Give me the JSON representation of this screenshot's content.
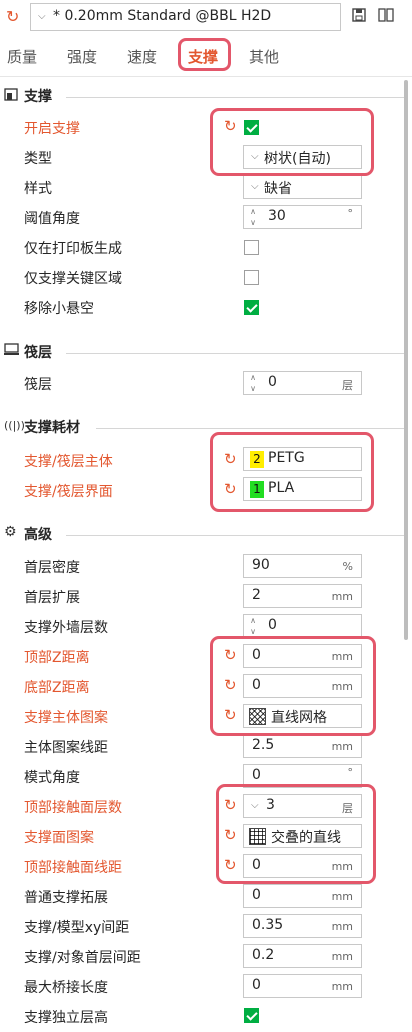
{
  "header": {
    "preset_name": "* 0.20mm Standard @BBL H2D",
    "icons": [
      "refresh-icon",
      "save-icon",
      "compare-icon"
    ]
  },
  "tabs": [
    "质量",
    "强度",
    "速度",
    "支撑",
    "其他"
  ],
  "active_tab": "支撑",
  "sections": {
    "support": "支撑",
    "raft": "筏层",
    "filament": "支撑耗材",
    "advanced": "高级"
  },
  "support": {
    "enable": {
      "label": "开启支撑",
      "checked": true
    },
    "type": {
      "label": "类型",
      "value": "树状(自动)"
    },
    "style": {
      "label": "样式",
      "value": "缺省"
    },
    "threshold": {
      "label": "阈值角度",
      "value": "30",
      "unit": "°"
    },
    "buildplate_only": {
      "label": "仅在打印板生成",
      "checked": false
    },
    "critical_only": {
      "label": "仅支撑关键区域",
      "checked": false
    },
    "remove_small": {
      "label": "移除小悬空",
      "checked": true
    }
  },
  "raft": {
    "layers": {
      "label": "筏层",
      "value": "0",
      "unit": "层"
    }
  },
  "filament": {
    "base": {
      "label": "支撑/筏层主体",
      "slot": "2",
      "value": "PETG",
      "color": "#ffee00"
    },
    "interface": {
      "label": "支撑/筏层界面",
      "slot": "1",
      "value": "PLA",
      "color": "#22dd22"
    }
  },
  "advanced": {
    "initial_density": {
      "label": "首层密度",
      "value": "90",
      "unit": "%"
    },
    "initial_expansion": {
      "label": "首层扩展",
      "value": "2",
      "unit": "mm"
    },
    "wall_loops": {
      "label": "支撑外墙层数",
      "value": "0"
    },
    "top_z": {
      "label": "顶部Z距离",
      "value": "0",
      "unit": "mm"
    },
    "bottom_z": {
      "label": "底部Z距离",
      "value": "0",
      "unit": "mm"
    },
    "base_pattern": {
      "label": "支撑主体图案",
      "value": "直线网格"
    },
    "base_spacing": {
      "label": "主体图案线距",
      "value": "2.5",
      "unit": "mm"
    },
    "pattern_angle": {
      "label": "模式角度",
      "value": "0",
      "unit": "°"
    },
    "top_iface_layers": {
      "label": "顶部接触面层数",
      "value": "3",
      "unit": "层"
    },
    "iface_pattern": {
      "label": "支撑面图案",
      "value": "交叠的直线"
    },
    "top_iface_spacing": {
      "label": "顶部接触面线距",
      "value": "0",
      "unit": "mm"
    },
    "normal_expansion": {
      "label": "普通支撑拓展",
      "value": "0",
      "unit": "mm"
    },
    "xy_distance": {
      "label": "支撑/模型xy间距",
      "value": "0.35",
      "unit": "mm"
    },
    "first_layer_gap": {
      "label": "支撑/对象首层间距",
      "value": "0.2",
      "unit": "mm"
    },
    "max_bridge": {
      "label": "最大桥接长度",
      "value": "0",
      "unit": "mm"
    },
    "independent_layer": {
      "label": "支撑独立层高",
      "checked": true
    }
  },
  "colors": {
    "accent": "#e3572f",
    "highlight": "#e3576a",
    "check": "#00ae42"
  }
}
